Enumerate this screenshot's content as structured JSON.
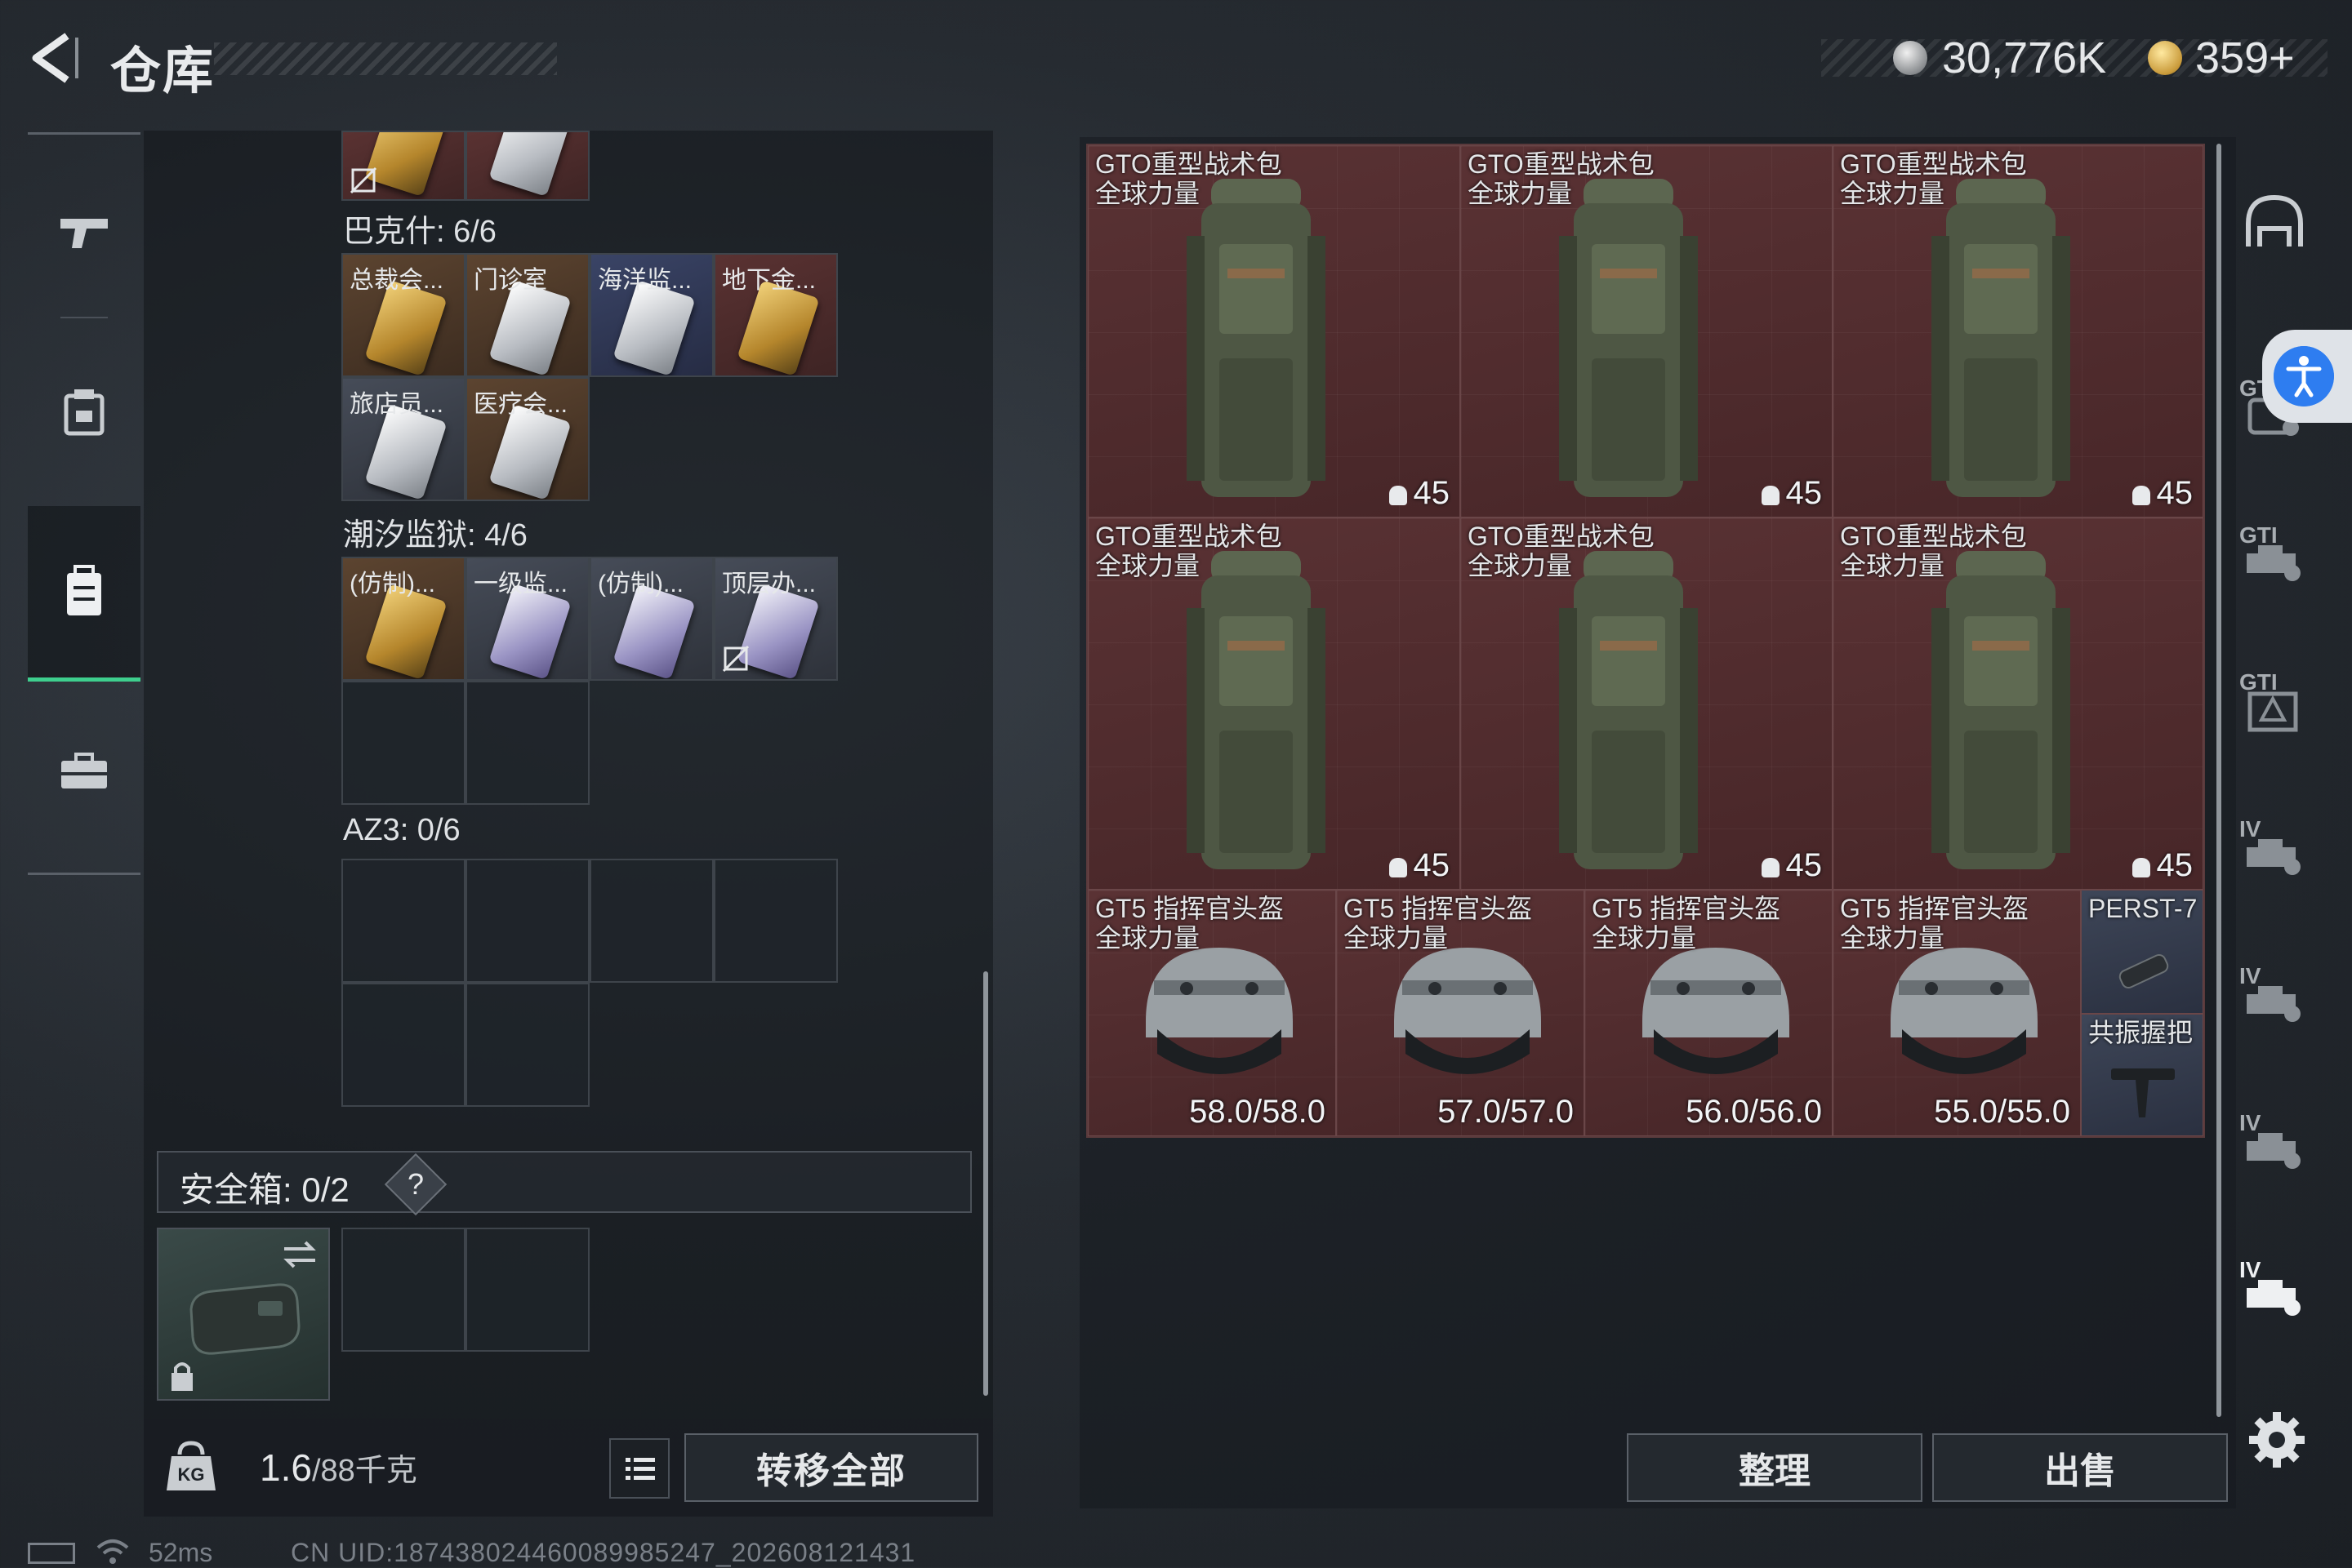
{
  "header": {
    "title": "仓库",
    "currency_1": "30,776K",
    "currency_2": "359+"
  },
  "left_nav": {
    "items": [
      {
        "icon": "weapon-icon"
      },
      {
        "icon": "gear-vest-icon"
      },
      {
        "icon": "backpack-icon",
        "active": true
      },
      {
        "icon": "toolbox-icon"
      }
    ]
  },
  "keycard_sections": [
    {
      "label": "巴克什: 6/6",
      "cards": [
        "总裁会...",
        "门诊室",
        "海洋监...",
        "地下金...",
        "旅店员...",
        "医疗会..."
      ]
    },
    {
      "label": "潮汐监狱: 4/6",
      "cards": [
        "(仿制)...",
        "一级监...",
        "(仿制)...",
        "顶层办..."
      ]
    },
    {
      "label": "AZ3: 0/6",
      "cards": []
    }
  ],
  "safebox": {
    "label": "安全箱: 0/2",
    "help": "?"
  },
  "footer_left": {
    "weight_value": "1.6",
    "weight_capacity": "/88千克",
    "transfer_all": "转移全部"
  },
  "storage_items": {
    "backpacks": [
      {
        "name_1": "GTO重型战术包",
        "name_2": "全球力量",
        "capacity": "45"
      },
      {
        "name_1": "GTO重型战术包",
        "name_2": "全球力量",
        "capacity": "45"
      },
      {
        "name_1": "GTO重型战术包",
        "name_2": "全球力量",
        "capacity": "45"
      },
      {
        "name_1": "GTO重型战术包",
        "name_2": "全球力量",
        "capacity": "45"
      },
      {
        "name_1": "GTO重型战术包",
        "name_2": "全球力量",
        "capacity": "45"
      },
      {
        "name_1": "GTO重型战术包",
        "name_2": "全球力量",
        "capacity": "45"
      }
    ],
    "helmets": [
      {
        "name_1": "GT5 指挥官头盔",
        "name_2": "全球力量",
        "durability": "58.0/58.0"
      },
      {
        "name_1": "GT5 指挥官头盔",
        "name_2": "全球力量",
        "durability": "57.0/57.0"
      },
      {
        "name_1": "GT5 指挥官头盔",
        "name_2": "全球力量",
        "durability": "56.0/56.0"
      },
      {
        "name_1": "GT5 指挥官头盔",
        "name_2": "全球力量",
        "durability": "55.0/55.0"
      }
    ],
    "small_items": [
      {
        "name": "PERST-7"
      },
      {
        "name": "共振握把"
      }
    ]
  },
  "actions": {
    "sort": "整理",
    "sell": "出售"
  },
  "filters": [
    {
      "icon": "helmet-filter-icon",
      "level": ""
    },
    {
      "icon": "gti-backpack-filter-icon",
      "level": "GTI"
    },
    {
      "icon": "gti-ammo-filter-icon",
      "level": "GTI"
    },
    {
      "icon": "gti-armor-filter-icon",
      "level": "GTI"
    },
    {
      "icon": "iv-ammo-filter-icon",
      "level": "IV"
    },
    {
      "icon": "iv-ammo-filter-icon",
      "level": "IV"
    },
    {
      "icon": "iv-ammo-filter-icon",
      "level": "IV"
    },
    {
      "icon": "iv-ammo-filter-icon",
      "level": "IV"
    }
  ],
  "status_bar": {
    "ping": "52ms",
    "uid": "CN UID:1874380244600899852​47_202608121431"
  },
  "colors": {
    "accent_green": "#3ecf8e",
    "item_bg_red": "#4a2a2c",
    "accessibility_blue": "#2e7df0"
  }
}
